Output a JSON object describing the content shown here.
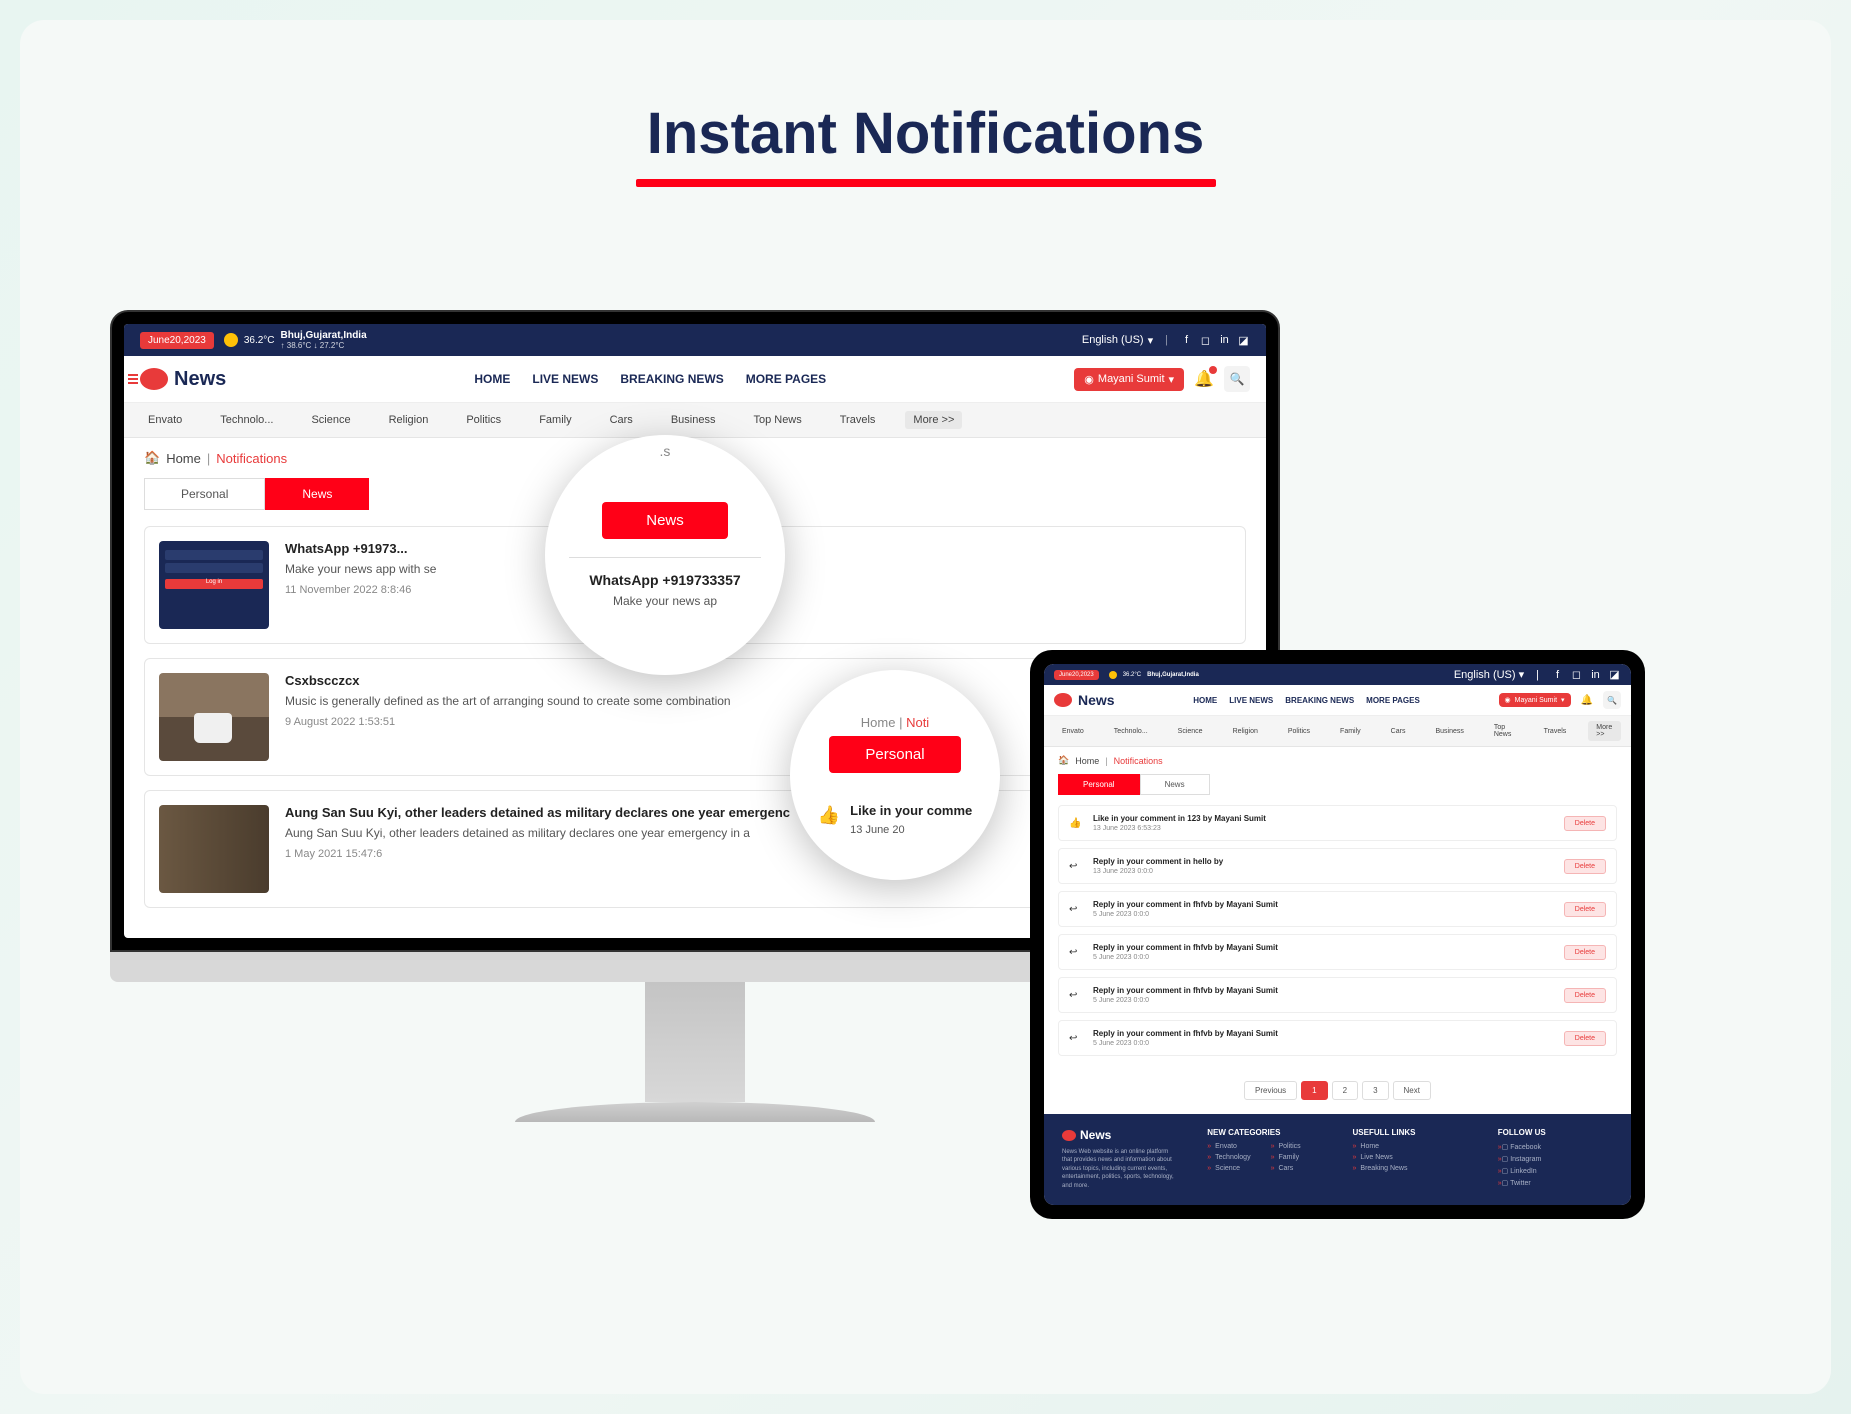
{
  "page_title": "Instant Notifications",
  "topbar": {
    "date": "June20,2023",
    "temp1": "36.2°C",
    "location": "Bhuj,Gujarat,India",
    "temp_hi": "↑ 38.6°C",
    "temp_lo": "↓ 27.2°C",
    "language": "English (US)"
  },
  "logo_text": "News",
  "nav": {
    "home": "HOME",
    "live": "LIVE NEWS",
    "breaking": "BREAKING NEWS",
    "more": "MORE PAGES"
  },
  "user": "Mayani Sumit",
  "categories": [
    "Envato",
    "Technolo...",
    "Science",
    "Religion",
    "Politics",
    "Family",
    "Cars",
    "Business",
    "Top News",
    "Travels"
  ],
  "more_label": "More >>",
  "breadcrumb": {
    "home": "Home",
    "current": "Notifications"
  },
  "tabs": {
    "personal": "Personal",
    "news": "News"
  },
  "news_items": [
    {
      "title": "WhatsApp +91973...",
      "desc": "Make your news app with se",
      "time": "11 November 2022 8:8:46",
      "login_btn": "Log in"
    },
    {
      "title": "Csxbscczcx",
      "desc": "Music is generally defined as the art of arranging sound to create some combination",
      "time": "9 August 2022 1:53:51"
    },
    {
      "title": "Aung San Suu Kyi, other leaders detained as military declares one year emergenc",
      "desc": "Aung San Suu Kyi, other leaders detained as military declares one year emergency in a",
      "time": "1 May 2021 15:47:6"
    }
  ],
  "personal_items": [
    {
      "title": "Like in your comment in 123 by Mayani Sumit",
      "time": "13 June 2023 6:53:23"
    },
    {
      "title": "Reply in your comment in hello by",
      "time": "13 June 2023 0:0:0"
    },
    {
      "title": "Reply in your comment in fhfvb by Mayani Sumit",
      "time": "5 June 2023 0:0:0"
    },
    {
      "title": "Reply in your comment in fhfvb by Mayani Sumit",
      "time": "5 June 2023 0:0:0"
    },
    {
      "title": "Reply in your comment in fhfvb by Mayani Sumit",
      "time": "5 June 2023 0:0:0"
    },
    {
      "title": "Reply in your comment in fhfvb by Mayani Sumit",
      "time": "5 June 2023 0:0:0"
    }
  ],
  "delete_label": "Delete",
  "pagination": {
    "prev": "Previous",
    "p1": "1",
    "p2": "2",
    "p3": "3",
    "next": "Next"
  },
  "footer": {
    "desc": "News Web website is an online platform that provides news and information about various topics, including current events, entertainment, politics, sports, technology, and more.",
    "cat_heading": "NEW CATEGORIES",
    "cats_left": [
      "Envato",
      "Technology",
      "Science"
    ],
    "cats_right": [
      "Politics",
      "Family",
      "Cars"
    ],
    "links_heading": "USEFULL LINKS",
    "links": [
      "Home",
      "Live News",
      "Breaking News"
    ],
    "follow_heading": "FOLLOW US",
    "socials": [
      "Facebook",
      "Instagram",
      "LinkedIn",
      "Twitter"
    ]
  },
  "zoom1": {
    "partial": ".s",
    "tab": "News",
    "title": "WhatsApp +919733357",
    "sub": "Make your news ap"
  },
  "zoom2": {
    "crumb_home": "Home",
    "crumb_cur": "Noti",
    "tab": "Personal",
    "title": "Like in your comme",
    "time": "13 June 20"
  }
}
